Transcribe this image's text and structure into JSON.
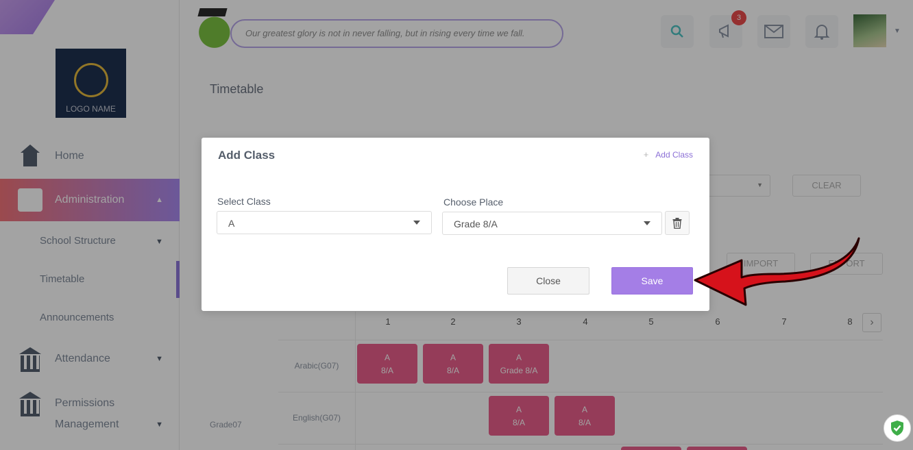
{
  "sidebar": {
    "logo_text": "LOGO NAME",
    "items": [
      {
        "label": "Home"
      },
      {
        "label": "Administration"
      },
      {
        "label": "Attendance"
      },
      {
        "label": "Permissions"
      },
      {
        "label": "Management"
      }
    ],
    "sub_items": [
      {
        "label": "School Structure"
      },
      {
        "label": "Timetable"
      },
      {
        "label": "Announcements"
      }
    ]
  },
  "header": {
    "quote": "Our greatest glory is not in never falling, but in rising every time we fall.",
    "notification_count": "3"
  },
  "page": {
    "title": "Timetable",
    "clear_label": "CLEAR",
    "import_label": "IMPORT",
    "export_label": "EXPORT",
    "periods": [
      "1",
      "2",
      "3",
      "4",
      "5",
      "6",
      "7",
      "8"
    ],
    "grade_label": "Grade07",
    "rows": [
      {
        "subject": "Arabic(G07)",
        "cells": [
          {
            "line1": "A",
            "line2": "8/A"
          },
          {
            "line1": "A",
            "line2": "8/A"
          },
          {
            "line1": "A",
            "line2": "Grade 8/A"
          }
        ]
      },
      {
        "subject": "English(G07)",
        "cells": [
          {
            "line1": "A",
            "line2": "8/A"
          },
          {
            "line1": "A",
            "line2": "8/A"
          }
        ]
      }
    ]
  },
  "modal": {
    "title": "Add Class",
    "add_link_label": "Add Class",
    "select_class_label": "Select Class",
    "select_class_value": "A",
    "choose_place_label": "Choose Place",
    "choose_place_value": "Grade 8/A",
    "close_label": "Close",
    "save_label": "Save"
  },
  "colors": {
    "accent": "#a47ee6",
    "annotation_arrow": "#d6121b",
    "timetable_cell": "#e95f8b"
  }
}
